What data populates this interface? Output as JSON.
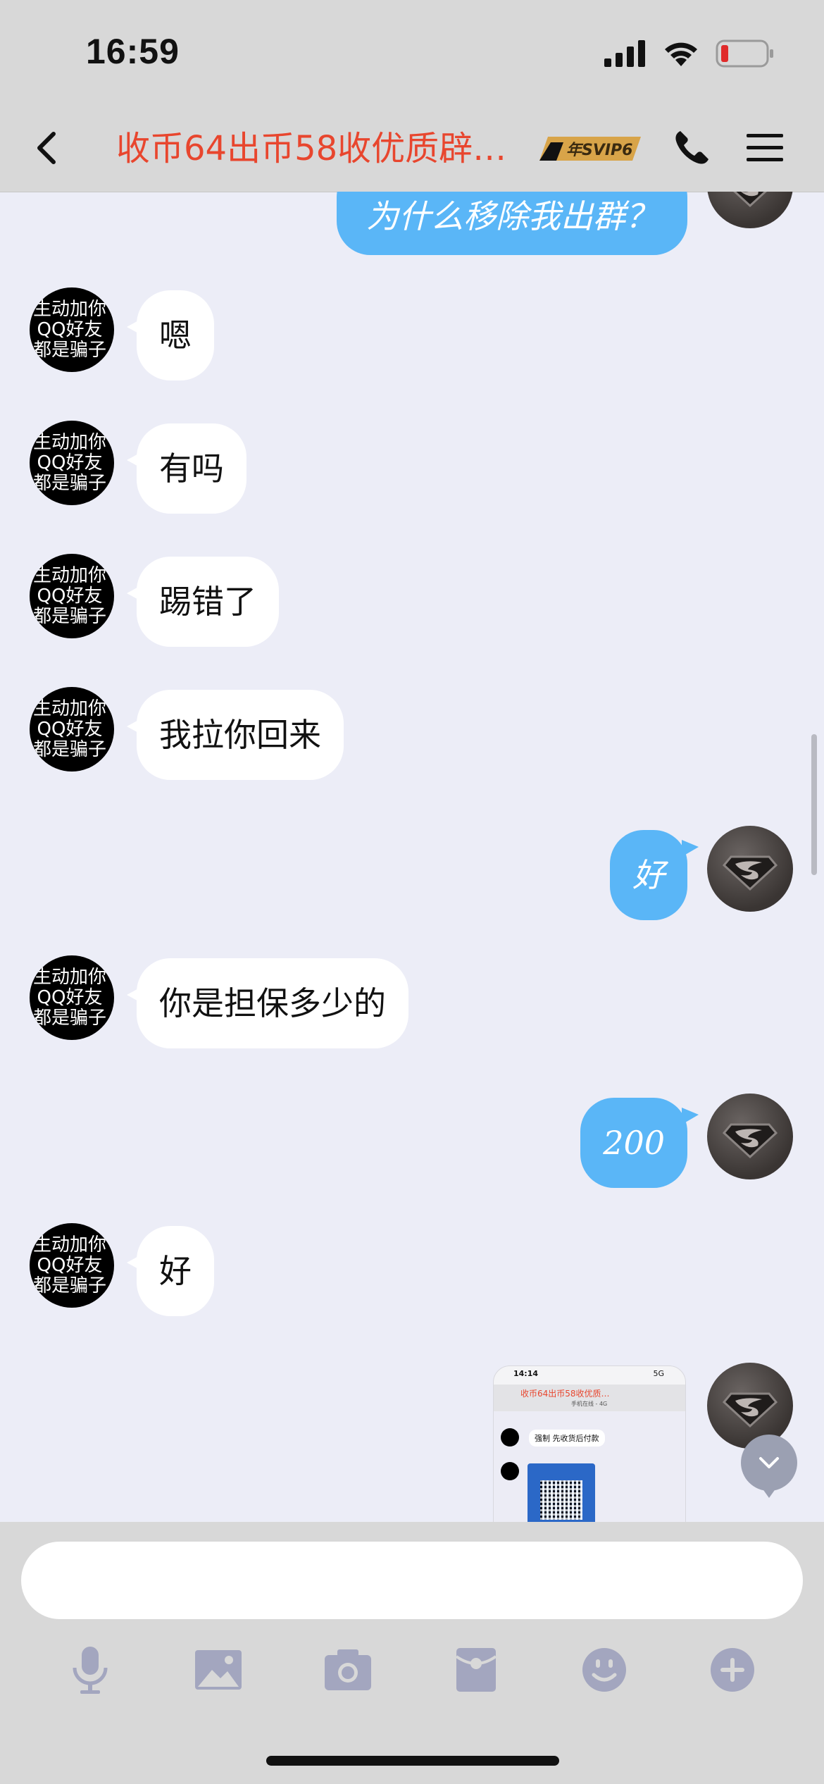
{
  "status": {
    "time": "16:59"
  },
  "header": {
    "title": "收币64出币58收优质辟…",
    "badge": "年SVIP6"
  },
  "avatar_other_lines": [
    "生动加你",
    "QQ好友",
    "都是骗子"
  ],
  "messages": [
    {
      "side": "me",
      "text": "为什么移除我出群？"
    },
    {
      "side": "other",
      "text": "嗯"
    },
    {
      "side": "other",
      "text": "有吗"
    },
    {
      "side": "other",
      "text": "踢错了"
    },
    {
      "side": "other",
      "text": "我拉你回来"
    },
    {
      "side": "me",
      "text": "好"
    },
    {
      "side": "other",
      "text": "你是担保多少的"
    },
    {
      "side": "me",
      "text": "200"
    },
    {
      "side": "other",
      "text": "好"
    }
  ],
  "screenshot_thumb": {
    "time": "14:14",
    "signal": "5G",
    "title": "收币64出币58收优质…",
    "subtitle": "手机在线 - 4G",
    "message": "强制 先收货后付款"
  },
  "composer": {
    "placeholder": ""
  },
  "toolbar": [
    "mic-icon",
    "image-icon",
    "camera-icon",
    "red-packet-icon",
    "emoji-icon",
    "plus-icon"
  ],
  "colors": {
    "title": "#E8462E",
    "bubble_me": "#5AB6F7",
    "bubble_other": "#FFFFFF",
    "background": "#ECEDF7",
    "bars": "#D8D8D8",
    "tool_icon": "#A3A6BF"
  }
}
